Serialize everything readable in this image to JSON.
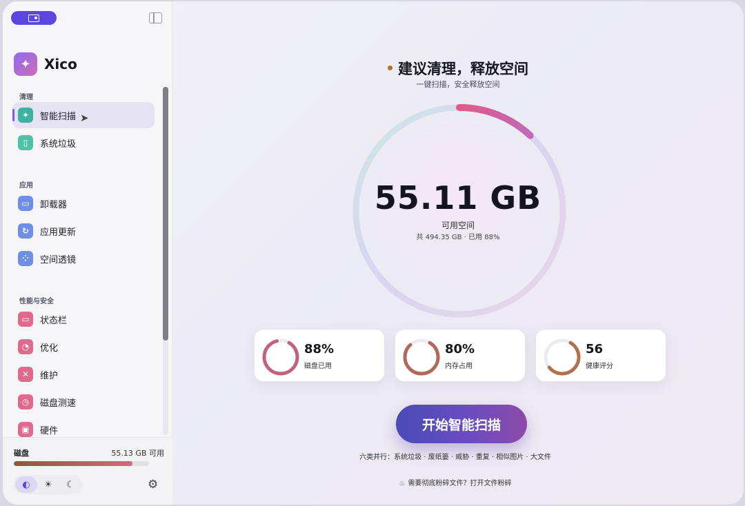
{
  "app": {
    "name": "Xico"
  },
  "sidebar": {
    "sections": [
      {
        "label": "清理"
      },
      {
        "label": "应用"
      },
      {
        "label": "性能与安全"
      }
    ],
    "items": [
      {
        "label": "智能扫描",
        "icon": "sparkle-icon",
        "color": "#3fb1a0",
        "active": true
      },
      {
        "label": "系统垃圾",
        "icon": "trash-icon",
        "color": "#4fc1a4"
      },
      {
        "label": "卸载器",
        "icon": "box-icon",
        "color": "#6f8fe6"
      },
      {
        "label": "应用更新",
        "icon": "refresh-icon",
        "color": "#6f8fe6"
      },
      {
        "label": "空间透镜",
        "icon": "bubbles-icon",
        "color": "#6f8fe6"
      },
      {
        "label": "状态栏",
        "icon": "window-icon",
        "color": "#e06a8e"
      },
      {
        "label": "优化",
        "icon": "gauge-icon",
        "color": "#e06a8e"
      },
      {
        "label": "维护",
        "icon": "tools-icon",
        "color": "#e06a8e"
      },
      {
        "label": "磁盘测速",
        "icon": "speedometer-icon",
        "color": "#e06a8e"
      },
      {
        "label": "硬件",
        "icon": "chip-icon",
        "color": "#e06a8e"
      }
    ],
    "disk": {
      "title": "磁盘",
      "free": "55.13 GB 可用",
      "used_fraction": 0.88
    },
    "theme": {
      "selected": "auto",
      "options": [
        "auto-theme-icon",
        "sun-icon",
        "moon-icon"
      ]
    }
  },
  "main": {
    "headline": "建议清理，释放空间",
    "subline": "一键扫描，安全释放空间",
    "available": "55.11 GB",
    "available_caption": "可用空间",
    "detail": "共 494.35 GB · 已用 88%",
    "ring_used_fraction": 0.12,
    "stats": [
      {
        "value": "88%",
        "label": "磁盘已用",
        "fraction": 0.88
      },
      {
        "value": "80%",
        "label": "内存占用",
        "fraction": 0.8
      },
      {
        "value": "56",
        "label": "健康评分",
        "fraction": 0.56
      }
    ],
    "start_button": "开始智能扫描",
    "categories": "六类并行：系统垃圾 · 废纸篓 · 威胁 · 重复 · 相似图片 · 大文件",
    "shred_hint": "需要彻底粉碎文件？打开文件粉碎"
  }
}
